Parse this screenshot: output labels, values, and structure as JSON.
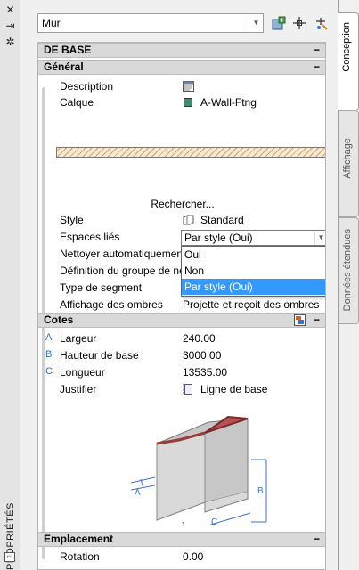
{
  "palette": {
    "title": "PROPRIÉTÉS",
    "close_icon": "close-icon",
    "autohide_icon": "autohide-icon",
    "settings_icon": "settings-icon"
  },
  "object_type": {
    "value": "Mur"
  },
  "toolbar": {
    "add_icon": "add-style-icon",
    "select_icon": "select-objects-icon",
    "quickselect_icon": "quick-select-icon"
  },
  "tabs": [
    {
      "label": "Conception",
      "active": true
    },
    {
      "label": "Affichage",
      "active": false
    },
    {
      "label": "Données étendues",
      "active": false
    }
  ],
  "sections": {
    "base": {
      "title": "DE BASE",
      "collapse": "−"
    },
    "general": {
      "title": "Général",
      "collapse": "−"
    },
    "cotes": {
      "title": "Cotes",
      "collapse": "−"
    },
    "emplacement": {
      "title": "Emplacement",
      "collapse": "−"
    }
  },
  "general": {
    "description": {
      "label": "Description",
      "value": ""
    },
    "calque": {
      "label": "Calque",
      "value": "A-Wall-Ftng",
      "swatch": "#3d8f6e"
    },
    "find": "Rechercher...",
    "style": {
      "label": "Style",
      "value": "Standard"
    },
    "espaces": {
      "label": "Espaces liés",
      "value": "Par style (Oui)"
    },
    "nettoyer": {
      "label": "Nettoyer automatiquement"
    },
    "definition": {
      "label": "Définition du groupe de nettoyage"
    },
    "segment": {
      "label": "Type de segment"
    },
    "ombres": {
      "label": "Affichage des ombres",
      "value": "Projette et reçoit des ombres"
    }
  },
  "dropdown": {
    "options": [
      "Oui",
      "Non",
      "Par style (Oui)"
    ],
    "selected": "Par style (Oui)"
  },
  "cotes": {
    "largeur": {
      "letter": "A",
      "label": "Largeur",
      "value": "240.00"
    },
    "hauteur": {
      "letter": "B",
      "label": "Hauteur de base",
      "value": "3000.00"
    },
    "longueur": {
      "letter": "C",
      "label": "Longueur",
      "value": "13535.00"
    },
    "justifier": {
      "label": "Justifier",
      "value": "Ligne de base"
    },
    "diagram": {
      "a": "A",
      "b": "B",
      "c": "C"
    }
  },
  "emplacement": {
    "rotation": {
      "label": "Rotation",
      "value": "0.00"
    }
  }
}
